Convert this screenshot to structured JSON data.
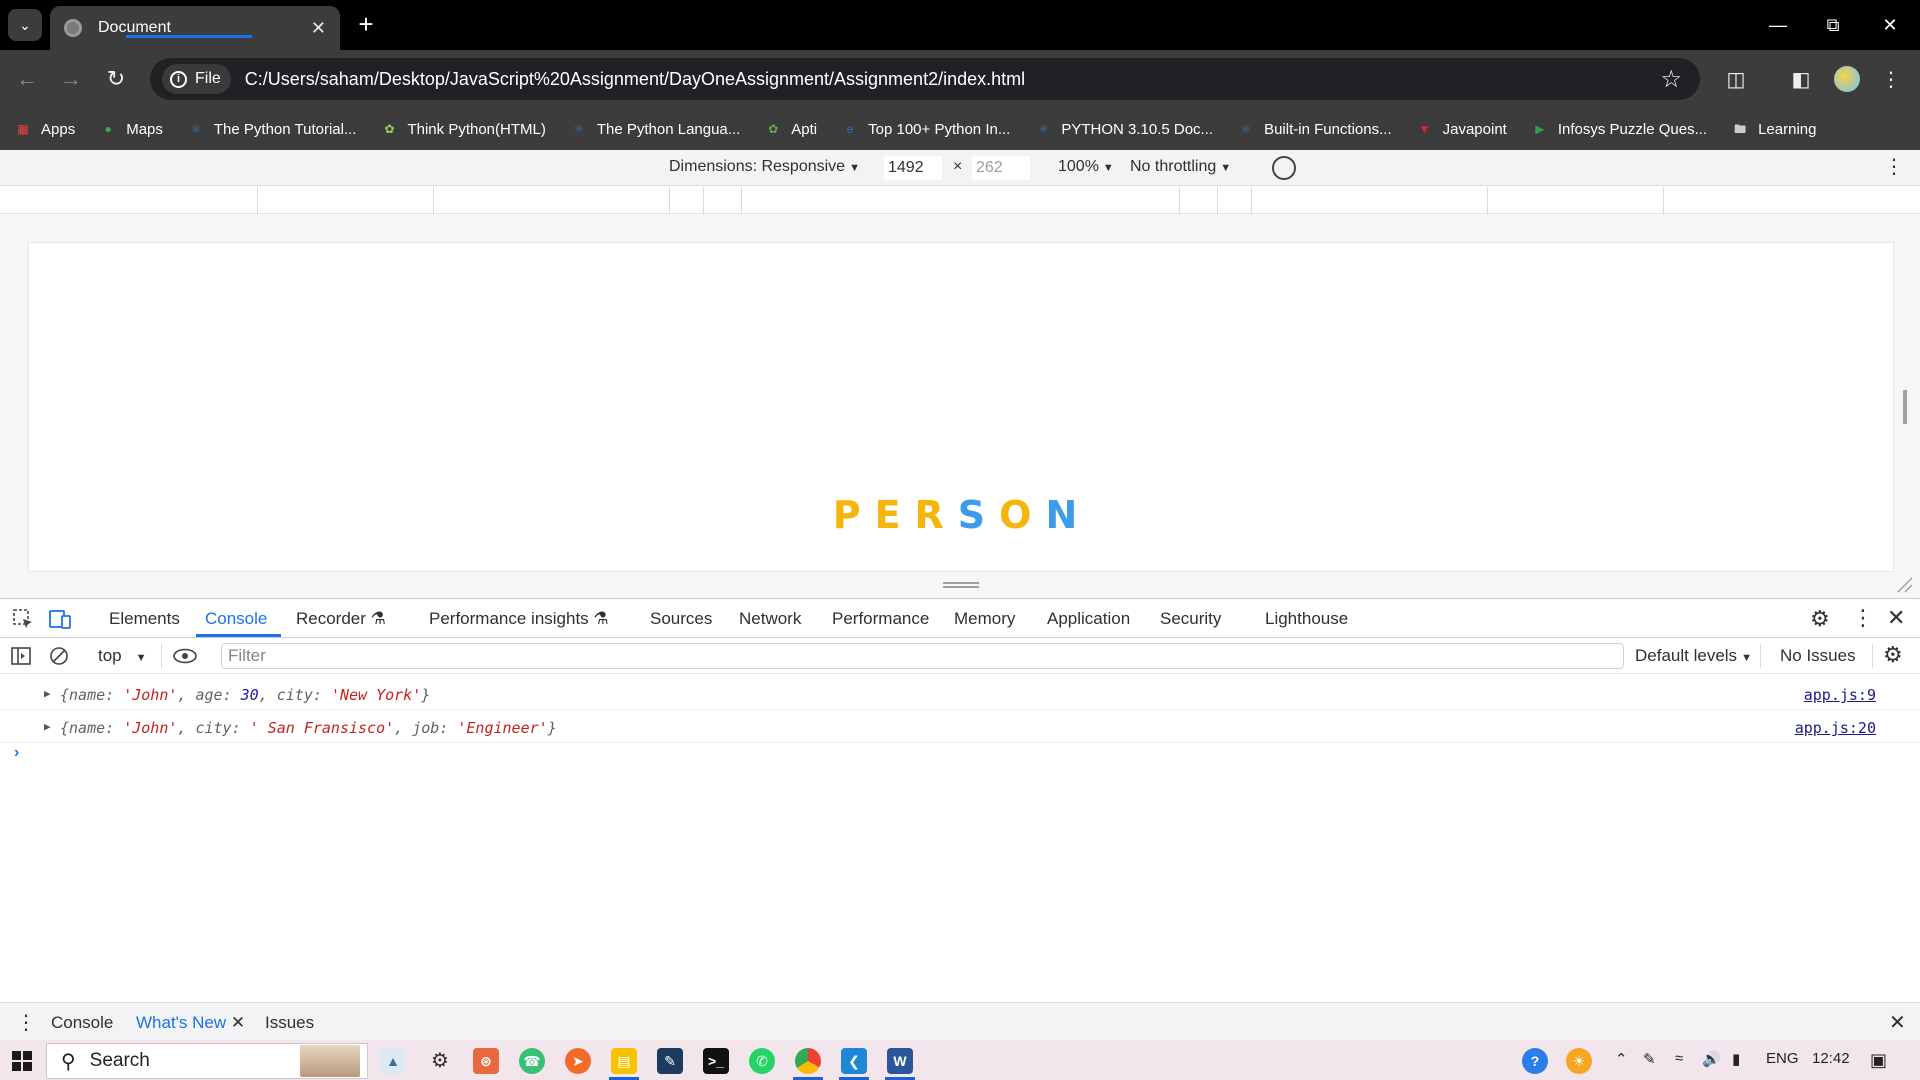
{
  "browser": {
    "tab_title": "Document",
    "url_chip": "File",
    "url": "C:/Users/saham/Desktop/JavaScript%20Assignment/DayOneAssignment/Assignment2/index.html",
    "bookmarks": [
      {
        "label": "Apps",
        "icon": "apps-grid-icon",
        "color": "#e94235"
      },
      {
        "label": "Maps",
        "icon": "maps-pin-icon",
        "color": "#34a853"
      },
      {
        "label": "The Python Tutorial...",
        "icon": "python-icon",
        "color": "#3b77a8"
      },
      {
        "label": "Think Python(HTML)",
        "icon": "leaf-icon",
        "color": "#9bd36b"
      },
      {
        "label": "The Python Langua...",
        "icon": "python-icon",
        "color": "#3b77a8"
      },
      {
        "label": "Apti",
        "icon": "leaf-icon",
        "color": "#6aa84f"
      },
      {
        "label": "Top 100+ Python In...",
        "icon": "e-icon",
        "color": "#1f6fd1"
      },
      {
        "label": "PYTHON 3.10.5 Doc...",
        "icon": "python-icon",
        "color": "#3b77a8"
      },
      {
        "label": "Built-in Functions...",
        "icon": "python-icon",
        "color": "#3b77a8"
      },
      {
        "label": "Javapoint",
        "icon": "javapoint-icon",
        "color": "#e8202a"
      },
      {
        "label": "Infosys Puzzle Ques...",
        "icon": "play-icon",
        "color": "#2ea043"
      },
      {
        "label": "Learning",
        "icon": "folder-icon",
        "color": "#cccccc"
      }
    ]
  },
  "device_toolbar": {
    "dimensions_label": "Dimensions: Responsive",
    "width": "1492",
    "height": "262",
    "times": "×",
    "zoom": "100%",
    "throttling": "No throttling"
  },
  "page": {
    "heading_letters": [
      {
        "char": "P",
        "color": "#f5b50a"
      },
      {
        "char": "E",
        "color": "#f5b50a"
      },
      {
        "char": "R",
        "color": "#f5b50a"
      },
      {
        "char": "S",
        "color": "#3d9be9"
      },
      {
        "char": "O",
        "color": "#f5b50a"
      },
      {
        "char": "N",
        "color": "#3d9be9"
      }
    ]
  },
  "devtools": {
    "tabs": [
      "Elements",
      "Console",
      "Recorder",
      "Performance insights",
      "Sources",
      "Network",
      "Performance",
      "Memory",
      "Application",
      "Security",
      "Lighthouse"
    ],
    "active_tab": "Console",
    "context": "top",
    "filter_placeholder": "Filter",
    "default_levels": "Default levels",
    "no_issues": "No Issues",
    "logs": [
      {
        "parts": [
          {
            "t": "{",
            "c": "k"
          },
          {
            "t": "name",
            "c": "k"
          },
          {
            "t": ": ",
            "c": "k"
          },
          {
            "t": "'John'",
            "c": "s"
          },
          {
            "t": ", ",
            "c": "k"
          },
          {
            "t": "age",
            "c": "k"
          },
          {
            "t": ": ",
            "c": "k"
          },
          {
            "t": "30",
            "c": "n"
          },
          {
            "t": ", ",
            "c": "k"
          },
          {
            "t": "city",
            "c": "k"
          },
          {
            "t": ": ",
            "c": "k"
          },
          {
            "t": "'New York'",
            "c": "s"
          },
          {
            "t": "}",
            "c": "k"
          }
        ],
        "source": "app.js:9"
      },
      {
        "parts": [
          {
            "t": "{",
            "c": "k"
          },
          {
            "t": "name",
            "c": "k"
          },
          {
            "t": ": ",
            "c": "k"
          },
          {
            "t": "'John'",
            "c": "s"
          },
          {
            "t": ", ",
            "c": "k"
          },
          {
            "t": "city",
            "c": "k"
          },
          {
            "t": ": ",
            "c": "k"
          },
          {
            "t": "' San Fransisco'",
            "c": "s"
          },
          {
            "t": ", ",
            "c": "k"
          },
          {
            "t": "job",
            "c": "k"
          },
          {
            "t": ": ",
            "c": "k"
          },
          {
            "t": "'Engineer'",
            "c": "s"
          },
          {
            "t": "}",
            "c": "k"
          }
        ],
        "source": "app.js:20"
      }
    ],
    "drawer_tabs": [
      "Console",
      "What's New",
      "Issues"
    ],
    "drawer_active": "What's New"
  },
  "taskbar": {
    "search_label": "Search",
    "language": "ENG",
    "time": "12:42"
  }
}
